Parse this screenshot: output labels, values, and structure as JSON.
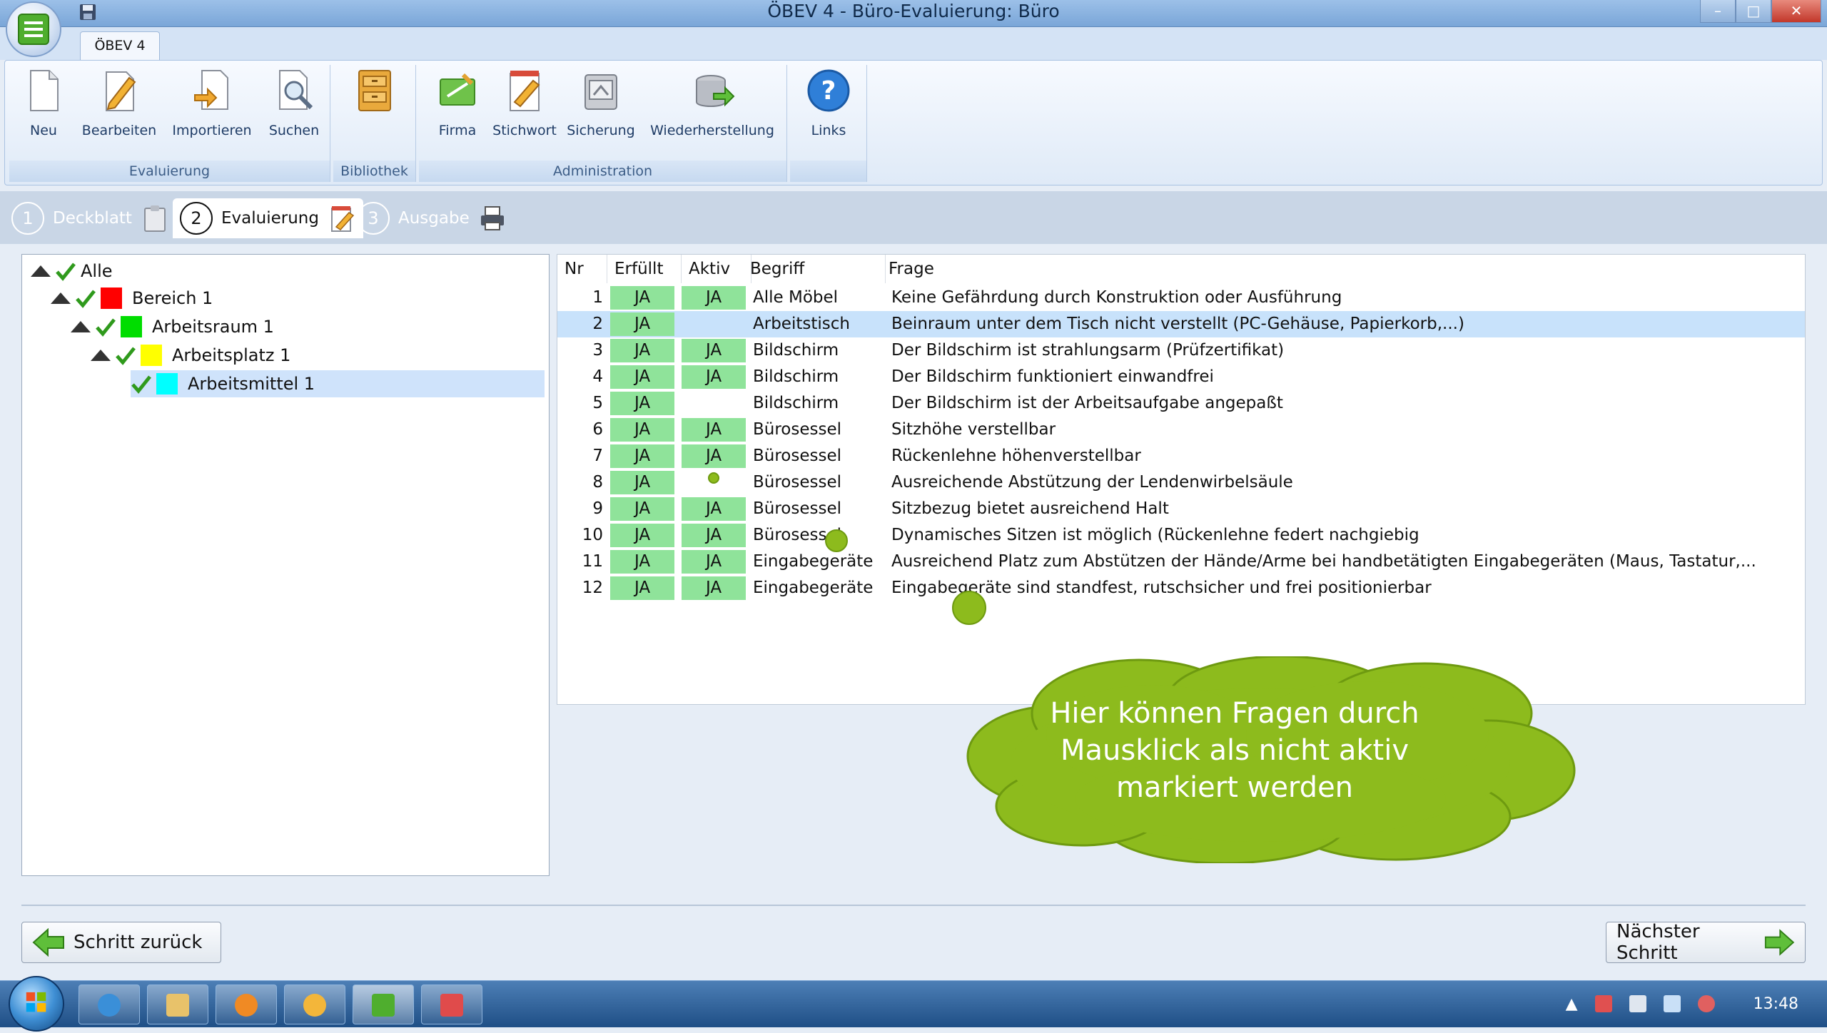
{
  "window": {
    "title": "ÖBEV 4 - Büro-Evaluierung: Büro"
  },
  "ribbon": {
    "tab": "ÖBEV 4",
    "groups": [
      {
        "label": "Evaluierung",
        "buttons": [
          "Neu",
          "Bearbeiten",
          "Importieren",
          "Suchen"
        ]
      },
      {
        "label": "Bibliothek",
        "buttons": [
          ""
        ]
      },
      {
        "label": "Administration",
        "buttons": [
          "Firma",
          "Stichwort",
          "Sicherung",
          "Wiederherstellung"
        ]
      },
      {
        "label": "",
        "buttons": [
          "Links"
        ]
      }
    ]
  },
  "steps": [
    {
      "num": "1",
      "label": "Deckblatt"
    },
    {
      "num": "2",
      "label": "Evaluierung"
    },
    {
      "num": "3",
      "label": "Ausgabe"
    }
  ],
  "tree": [
    {
      "label": "Alle",
      "color": ""
    },
    {
      "label": "Bereich 1",
      "color": "#ff0000"
    },
    {
      "label": "Arbeitsraum 1",
      "color": "#00dd00"
    },
    {
      "label": "Arbeitsplatz 1",
      "color": "#ffff00"
    },
    {
      "label": "Arbeitsmittel 1",
      "color": "#00ffff"
    }
  ],
  "table": {
    "headers": [
      "Nr",
      "Erfüllt",
      "Aktiv",
      "Begriff",
      "Frage"
    ],
    "rows": [
      {
        "nr": "1",
        "erfuellt": "JA",
        "aktiv": "JA",
        "begriff": "Alle Möbel",
        "frage": "Keine Gefährdung durch Konstruktion oder Ausführung"
      },
      {
        "nr": "2",
        "erfuellt": "JA",
        "aktiv": "",
        "begriff": "Arbeitstisch",
        "frage": "Beinraum unter dem Tisch nicht verstellt (PC-Gehäuse, Papierkorb,...)"
      },
      {
        "nr": "3",
        "erfuellt": "JA",
        "aktiv": "JA",
        "begriff": "Bildschirm",
        "frage": "Der Bildschirm ist strahlungsarm (Prüfzertifikat)"
      },
      {
        "nr": "4",
        "erfuellt": "JA",
        "aktiv": "JA",
        "begriff": "Bildschirm",
        "frage": "Der Bildschirm funktioniert einwandfrei"
      },
      {
        "nr": "5",
        "erfuellt": "JA",
        "aktiv": "",
        "begriff": "Bildschirm",
        "frage": "Der Bildschirm ist der Arbeitsaufgabe angepaßt"
      },
      {
        "nr": "6",
        "erfuellt": "JA",
        "aktiv": "JA",
        "begriff": "Bürosessel",
        "frage": "Sitzhöhe verstellbar"
      },
      {
        "nr": "7",
        "erfuellt": "JA",
        "aktiv": "JA",
        "begriff": "Bürosessel",
        "frage": "Rückenlehne höhenverstellbar"
      },
      {
        "nr": "8",
        "erfuellt": "JA",
        "aktiv": "",
        "begriff": "Bürosessel",
        "frage": "Ausreichende Abstützung der Lendenwirbelsäule"
      },
      {
        "nr": "9",
        "erfuellt": "JA",
        "aktiv": "JA",
        "begriff": "Bürosessel",
        "frage": "Sitzbezug bietet ausreichend Halt"
      },
      {
        "nr": "10",
        "erfuellt": "JA",
        "aktiv": "JA",
        "begriff": "Bürosessel",
        "frage": "Dynamisches Sitzen ist möglich (Rückenlehne federt nachgiebig"
      },
      {
        "nr": "11",
        "erfuellt": "JA",
        "aktiv": "JA",
        "begriff": "Eingabegeräte",
        "frage": "Ausreichend Platz zum Abstützen der Hände/Arme bei handbetätigten Eingabegeräten (Maus, Tastatur,..."
      },
      {
        "nr": "12",
        "erfuellt": "JA",
        "aktiv": "JA",
        "begriff": "Eingabegeräte",
        "frage": "Eingabegeräte sind standfest, rutschsicher und frei positionierbar"
      }
    ]
  },
  "callout": {
    "line1": "Hier können Fragen durch",
    "line2": "Mausklick als nicht aktiv",
    "line3": "markiert werden"
  },
  "nav": {
    "back": "Schritt zurück",
    "next": "Nächster Schritt"
  },
  "taskbar": {
    "clock": "13:48"
  }
}
